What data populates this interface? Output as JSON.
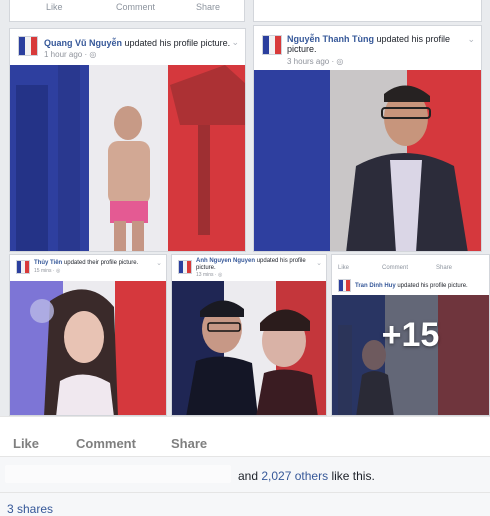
{
  "top_strip": {
    "left_label": "Like",
    "middle_label": "Comment",
    "right_label": "Share"
  },
  "posts": [
    {
      "name": "Quang Vũ Nguyễn",
      "action": "updated his profile picture.",
      "time": "1 hour ago"
    },
    {
      "name": "Nguyễn Thanh Tùng",
      "action": "updated his profile picture.",
      "time": "3 hours ago"
    },
    {
      "name": "Thủy Tiên",
      "action": "updated their profile picture.",
      "time": "15 mins"
    },
    {
      "name": "Anh Nguyen Nguyen",
      "action": "updated his profile picture.",
      "time": "13 mins"
    },
    {
      "name": "Tran Dinh Huy",
      "action": "updated his profile picture.",
      "time": ""
    }
  ],
  "mini_actions": {
    "like": "Like",
    "comment": "Comment",
    "share": "Share"
  },
  "more_count": "+15",
  "actions": {
    "like": "Like",
    "comment": "Comment",
    "share": "Share"
  },
  "likes": {
    "prefix": "and",
    "others_link": "2,027 others",
    "suffix": "like this."
  },
  "shares": {
    "label": "3 shares"
  },
  "colors": {
    "flag_blue": "#2e3f9f",
    "flag_white": "#ecebef",
    "flag_red": "#d5383d",
    "link": "#365899"
  },
  "icons": {
    "more": "chevron-down-icon",
    "privacy": "globe-icon"
  }
}
